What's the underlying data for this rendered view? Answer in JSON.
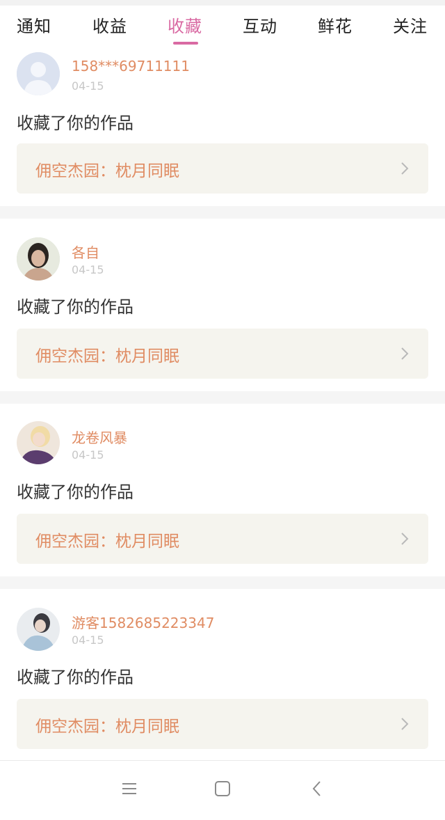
{
  "tabs": {
    "items": [
      {
        "label": "通知"
      },
      {
        "label": "收益"
      },
      {
        "label": "收藏"
      },
      {
        "label": "互动"
      },
      {
        "label": "鲜花"
      },
      {
        "label": "关注"
      }
    ],
    "active_index": 2,
    "active_color": "#d96aa3"
  },
  "items": [
    {
      "username": "158***69711111",
      "date": "04-15",
      "action": "收藏了你的作品",
      "work": "佣空杰园：枕月同眠",
      "avatar": "default-avatar-icon"
    },
    {
      "username": "各自",
      "date": "04-15",
      "action": "收藏了你的作品",
      "work": "佣空杰园：枕月同眠",
      "avatar": "user-photo"
    },
    {
      "username": "龙卷风暴",
      "date": "04-15",
      "action": "收藏了你的作品",
      "work": "佣空杰园：枕月同眠",
      "avatar": "user-photo"
    },
    {
      "username": "游客1582685223347",
      "date": "04-15",
      "action": "收藏了你的作品",
      "work": "佣空杰园：枕月同眠",
      "avatar": "user-photo"
    }
  ],
  "colors": {
    "username": "#e08c63",
    "work_bg": "#f5f4ee",
    "date": "#c7c7c7"
  },
  "navbar": {
    "icons": [
      "menu-icon",
      "home-square-icon",
      "back-chevron-icon"
    ]
  }
}
